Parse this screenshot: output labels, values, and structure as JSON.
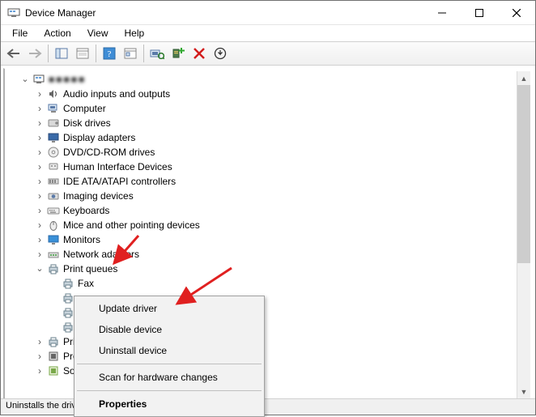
{
  "window": {
    "title": "Device Manager"
  },
  "menubar": {
    "items": [
      "File",
      "Action",
      "View",
      "Help"
    ]
  },
  "root": {
    "label": "PC"
  },
  "tree": [
    {
      "label": "Audio inputs and outputs",
      "icon": "speaker"
    },
    {
      "label": "Computer",
      "icon": "computer"
    },
    {
      "label": "Disk drives",
      "icon": "disk"
    },
    {
      "label": "Display adapters",
      "icon": "display"
    },
    {
      "label": "DVD/CD-ROM drives",
      "icon": "disc"
    },
    {
      "label": "Human Interface Devices",
      "icon": "hid"
    },
    {
      "label": "IDE ATA/ATAPI controllers",
      "icon": "ide"
    },
    {
      "label": "Imaging devices",
      "icon": "imaging"
    },
    {
      "label": "Keyboards",
      "icon": "keyboard"
    },
    {
      "label": "Mice and other pointing devices",
      "icon": "mouse"
    },
    {
      "label": "Monitors",
      "icon": "monitor"
    },
    {
      "label": "Network adapters",
      "icon": "network"
    }
  ],
  "print_queues": {
    "label": "Print queues",
    "children": [
      {
        "label": "Fax",
        "icon": "printer"
      },
      {
        "label": "",
        "icon": "printer",
        "selected": true,
        "cut": true
      },
      {
        "label": "",
        "icon": "printer"
      },
      {
        "label": "",
        "icon": "printer"
      }
    ]
  },
  "tail": [
    {
      "label": "Pri",
      "icon": "printer"
    },
    {
      "label": "Pro",
      "icon": "cpu"
    },
    {
      "label": "Sof",
      "icon": "soft"
    }
  ],
  "contextmenu": {
    "items": [
      {
        "label": "Update driver"
      },
      {
        "label": "Disable device"
      },
      {
        "label": "Uninstall device"
      },
      {
        "sep": true
      },
      {
        "label": "Scan for hardware changes"
      },
      {
        "sep": true
      },
      {
        "label": "Properties",
        "bold": true
      }
    ]
  },
  "statusbar": {
    "text": "Uninstalls the driver for the selected device."
  }
}
